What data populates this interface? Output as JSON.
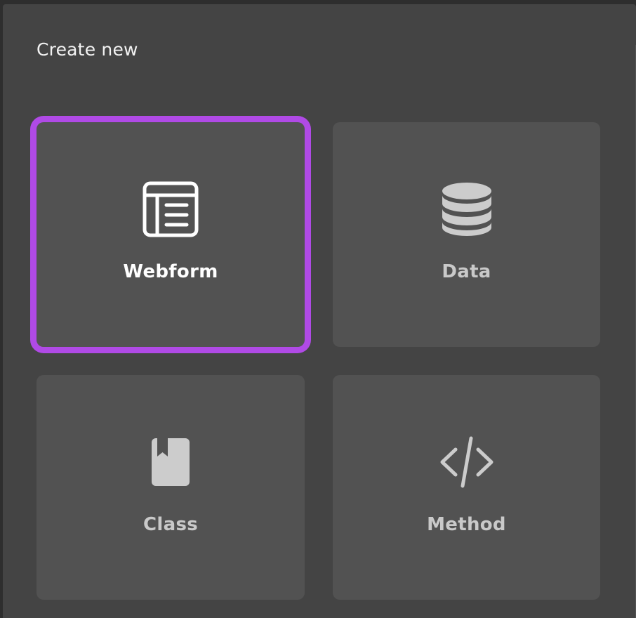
{
  "dialog": {
    "title": "Create new"
  },
  "tiles": [
    {
      "label": "Webform",
      "icon": "webform-icon",
      "selected": true
    },
    {
      "label": "Data",
      "icon": "database-icon",
      "selected": false
    },
    {
      "label": "Class",
      "icon": "book-icon",
      "selected": false
    },
    {
      "label": "Method",
      "icon": "code-icon",
      "selected": false
    }
  ],
  "colors": {
    "background": "#444444",
    "tile": "#525252",
    "selected_border": "#b04ae6",
    "icon": "#cccccc",
    "selected_icon": "#ffffff"
  }
}
